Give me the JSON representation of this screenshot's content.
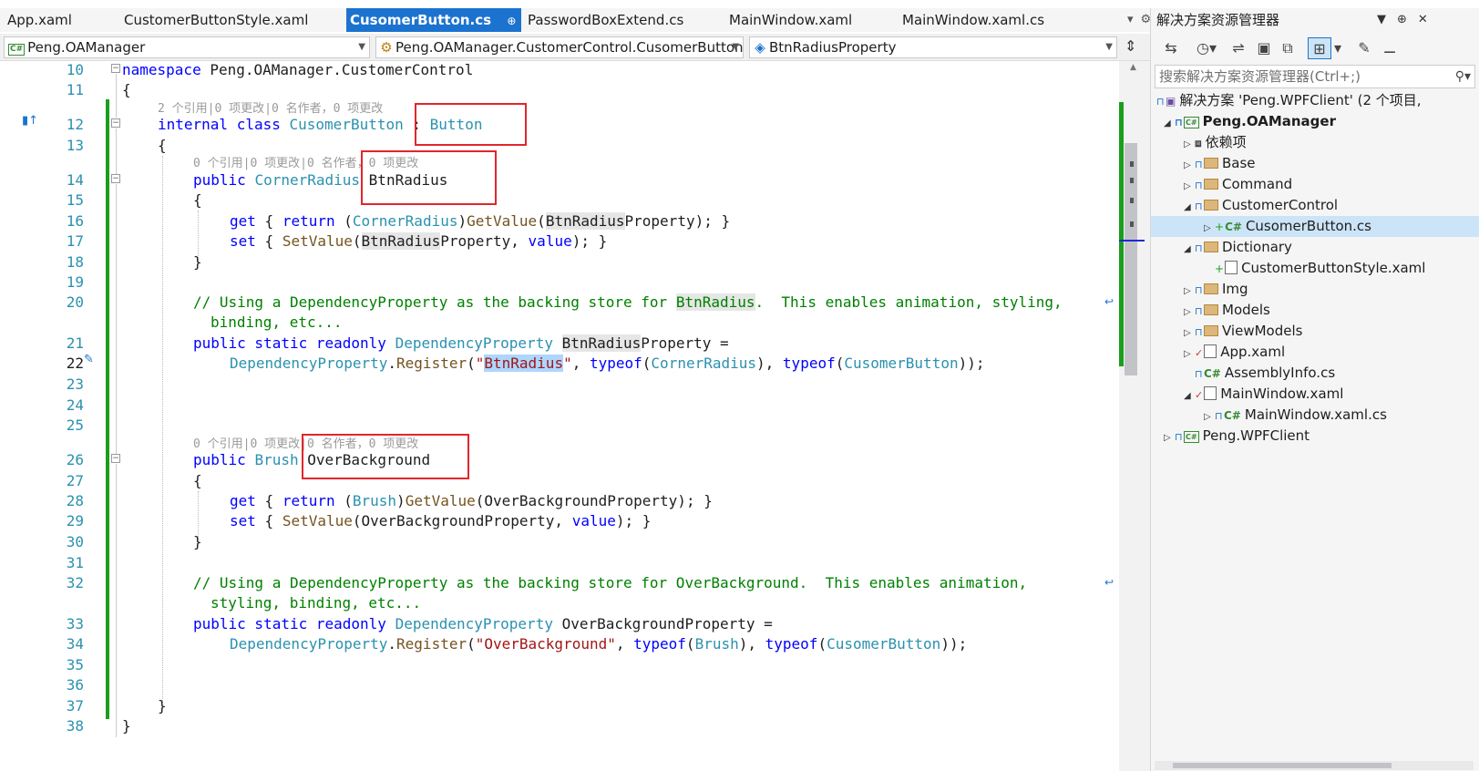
{
  "tabs": [
    {
      "label": "App.xaml",
      "active": false
    },
    {
      "label": "CustomerButtonStyle.xaml",
      "active": false
    },
    {
      "label": "CusomerButton.cs",
      "active": true,
      "pin": "⊕",
      "close": "✕"
    },
    {
      "label": "PasswordBoxExtend.cs",
      "active": false
    },
    {
      "label": "MainWindow.xaml",
      "active": false
    },
    {
      "label": "MainWindow.xaml.cs",
      "active": false
    }
  ],
  "nav": {
    "project": "Peng.OAManager",
    "type": "Peng.OAManager.CustomerControl.CusomerButton",
    "member": "BtnRadiusProperty"
  },
  "editor": {
    "lines": [
      "10",
      "11",
      "12",
      "13",
      "14",
      "15",
      "16",
      "17",
      "18",
      "19",
      "20",
      "21",
      "22",
      "23",
      "24",
      "25",
      "26",
      "27",
      "28",
      "29",
      "30",
      "31",
      "32",
      "33",
      "34",
      "35",
      "36",
      "37",
      "38"
    ],
    "current_line": "22",
    "lens_class": "2 个引用|0 项更改|0 名作者，0 项更改",
    "lens_prop": "0 个引用|0 项更改|0 名作者，0 项更改",
    "code": {
      "l10_kw": "namespace",
      "l10_name": " Peng.OAManager.CustomerControl",
      "l11": "{",
      "l12_kw1": "internal",
      "l12_kw2": "class",
      "l12_name": "CusomerButton",
      "l12_colon": " : ",
      "l12_base": "Button",
      "l13": "{",
      "l14_kw": "public",
      "l14_type": "CornerRadius",
      "l14_name": "BtnRadius",
      "l15": "{",
      "l16_get": "get",
      "l16_b1": " { ",
      "l16_ret": "return",
      "l16_p1": " (",
      "l16_type": "CornerRadius",
      "l16_p2": ")",
      "l16_fn": "GetValue",
      "l16_p3": "(",
      "l16_hl": "BtnRadius",
      "l16_rest": "Property); }",
      "l17_set": "set",
      "l17_b1": " { ",
      "l17_fn": "SetValue",
      "l17_p1": "(",
      "l17_hl": "BtnRadius",
      "l17_p2": "Property, ",
      "l17_val": "value",
      "l17_rest": "); }",
      "l18": "}",
      "l20_a": "// Using a DependencyProperty as the backing store for ",
      "l20_hl": "BtnRadius",
      "l20_b": ".  This enables animation, styling,",
      "l20_c": "binding, etc...",
      "l21_kw": "public static readonly",
      "l21_type": "DependencyProperty",
      "l21_hl": "BtnRadius",
      "l21_rest": "Property =",
      "l22_type": "DependencyProperty",
      "l22_dot": ".",
      "l22_fn": "Register",
      "l22_p1": "(",
      "l22_q1": "\"",
      "l22_sel": "BtnRadius",
      "l22_q2": "\"",
      "l22_c1": ", ",
      "l22_typeof1": "typeof",
      "l22_p2": "(",
      "l22_t1": "CornerRadius",
      "l22_p3": "), ",
      "l22_typeof2": "typeof",
      "l22_p4": "(",
      "l22_t2": "CusomerButton",
      "l22_end": "));",
      "l26_kw": "public",
      "l26_type": "Brush",
      "l26_name": "OverBackground",
      "l27": "{",
      "l28_get": "get",
      "l28_b1": " { ",
      "l28_ret": "return",
      "l28_p1": " (",
      "l28_type": "Brush",
      "l28_p2": ")",
      "l28_fn": "GetValue",
      "l28_rest": "(OverBackgroundProperty); }",
      "l29_set": "set",
      "l29_b1": " { ",
      "l29_fn": "SetValue",
      "l29_p1": "(OverBackgroundProperty, ",
      "l29_val": "value",
      "l29_rest": "); }",
      "l30": "}",
      "l32_a": "// Using a DependencyProperty as the backing store for OverBackground.  This enables animation,",
      "l32_b": "styling, binding, etc...",
      "l33_kw": "public static readonly",
      "l33_type": "DependencyProperty",
      "l33_rest": " OverBackgroundProperty =",
      "l34_type": "DependencyProperty",
      "l34_dot": ".",
      "l34_fn": "Register",
      "l34_p1": "(",
      "l34_str": "\"OverBackground\"",
      "l34_c1": ", ",
      "l34_typeof1": "typeof",
      "l34_p2": "(",
      "l34_t1": "Brush",
      "l34_p3": "), ",
      "l34_typeof2": "typeof",
      "l34_p4": "(",
      "l34_t2": "CusomerButton",
      "l34_end": "));",
      "l37": "}",
      "l38": "}"
    }
  },
  "solution_explorer": {
    "title": "解决方案资源管理器",
    "search_placeholder": "搜索解决方案资源管理器(Ctrl+;)",
    "tree": [
      {
        "label": "解决方案 'Peng.WPFClient' (2 个项目,"
      },
      {
        "label": "Peng.OAManager"
      },
      {
        "label": "依赖项"
      },
      {
        "label": "Base"
      },
      {
        "label": "Command"
      },
      {
        "label": "CustomerControl"
      },
      {
        "label": "CusomerButton.cs"
      },
      {
        "label": "Dictionary"
      },
      {
        "label": "CustomerButtonStyle.xaml"
      },
      {
        "label": "Img"
      },
      {
        "label": "Models"
      },
      {
        "label": "ViewModels"
      },
      {
        "label": "App.xaml"
      },
      {
        "label": "AssemblyInfo.cs"
      },
      {
        "label": "MainWindow.xaml"
      },
      {
        "label": "MainWindow.xaml.cs"
      },
      {
        "label": "Peng.WPFClient"
      }
    ]
  },
  "colors": {
    "tab_active": "#1c73cf",
    "keyword": "#0000ff",
    "type": "#2b91af",
    "string": "#a31515",
    "comment": "#008000",
    "annotation_box": "#e1262c",
    "change_bar": "#1b9e1b"
  }
}
